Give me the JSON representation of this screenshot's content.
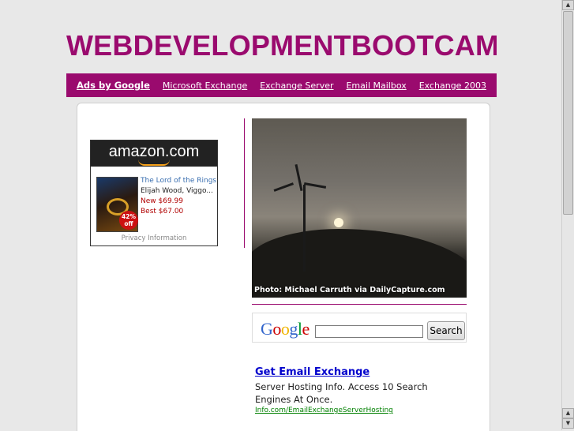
{
  "site": {
    "title": "WEBDEVELOPMENTBOOTCAMP"
  },
  "nav": {
    "ads_by_google": "Ads by Google",
    "links": [
      "Microsoft Exchange",
      "Exchange Server",
      "Email Mailbox",
      "Exchange 2003"
    ]
  },
  "amazon_widget": {
    "brand": "amazon.com",
    "product": {
      "title": "The Lord of the Rings",
      "cast": "Elijah Wood, Viggo...",
      "new_price": "New $69.99",
      "best_price": "Best $67.00",
      "discount_line1": "42%",
      "discount_line2": "off"
    },
    "privacy": "Privacy Information"
  },
  "photo": {
    "caption": "Photo: Michael Carruth via DailyCapture.com"
  },
  "google_search": {
    "logo_letters": [
      "G",
      "o",
      "o",
      "g",
      "l",
      "e"
    ],
    "logo_colors": [
      "#3366cc",
      "#cc0000",
      "#f0b400",
      "#3366cc",
      "#009933",
      "#cc0000"
    ],
    "button_label": "Search"
  },
  "ad": {
    "title": "Get Email Exchange",
    "description": "Server Hosting Info. Access 10 Search Engines At Once.",
    "url": "Info.com/EmailExchangeServerHosting"
  },
  "colors": {
    "brand": "#9a0a6e",
    "link": "#0000cc",
    "url": "#008000"
  },
  "icons": {
    "scroll_up": "arrow-up-icon",
    "scroll_down": "arrow-down-icon"
  }
}
